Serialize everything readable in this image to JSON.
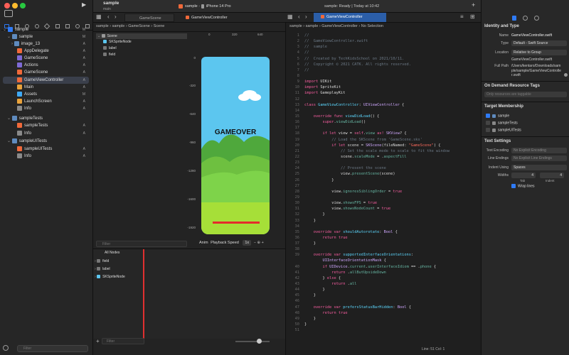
{
  "project": {
    "name": "sample",
    "branch": "main"
  },
  "toolbar": {
    "scheme": "sample",
    "device": "iPhone 14 Pro",
    "status": "sample: Ready | Today at 10:42"
  },
  "tabs": [
    {
      "label": "GameScene"
    },
    {
      "label": "GameViewController"
    }
  ],
  "active_tab": {
    "label": "GameViewController"
  },
  "navigator": {
    "items": [
      {
        "label": "sample",
        "badge": "M"
      },
      {
        "label": "sample",
        "badge": "M"
      },
      {
        "label": "image_13",
        "badge": "A"
      },
      {
        "label": "AppDelegate",
        "badge": "A"
      },
      {
        "label": "GameScene",
        "badge": "A"
      },
      {
        "label": "Actions",
        "badge": "A"
      },
      {
        "label": "GameScene",
        "badge": "A"
      },
      {
        "label": "GameViewController",
        "badge": "A"
      },
      {
        "label": "Main",
        "badge": "A"
      },
      {
        "label": "Assets",
        "badge": "M"
      },
      {
        "label": "LaunchScreen",
        "badge": "A"
      },
      {
        "label": "Info",
        "badge": "A"
      },
      {
        "label": "sampleTests",
        "badge": ""
      },
      {
        "label": "sampleTests",
        "badge": "A"
      },
      {
        "label": "Info",
        "badge": "A"
      },
      {
        "label": "sampleUITests",
        "badge": ""
      },
      {
        "label": "sampleUITests",
        "badge": "A"
      },
      {
        "label": "Info",
        "badge": "A"
      }
    ],
    "filter_placeholder": "Filter"
  },
  "scene_editor": {
    "breadcrumb": [
      "sample",
      "sample",
      "GameScene",
      "Scene"
    ],
    "tree": [
      "Scene",
      "SKSpriteNode",
      "label",
      "field"
    ],
    "ruler_top": [
      "0",
      "320",
      "640"
    ],
    "ruler_left": [
      "0",
      "-320",
      "-640",
      "-960",
      "-1280",
      "-1600",
      "-1920"
    ],
    "game_label": "GAMEOVER",
    "anim_label": "Anim",
    "playback_label": "Playback Speed",
    "speed_value": "1x",
    "filter_placeholder": "Filter",
    "timeline_header": "All Nodes",
    "timeline_rows": [
      "field",
      "label",
      "SKSpriteNode"
    ]
  },
  "code_editor": {
    "breadcrumb": [
      "sample",
      "sample",
      "GameViewController",
      "No Selection"
    ],
    "status": {
      "line": "Line: 51",
      "col": "Col: 1"
    }
  },
  "inspector": {
    "section_identity": "Identity and Type",
    "name_label": "Name",
    "name_value": "GameViewController.swift",
    "type_label": "Type",
    "type_value": "Default - Swift Source",
    "location_label": "Location",
    "location_value": "Relative to Group",
    "location_file": "GameViewController.swift",
    "fullpath_label": "Full Path",
    "fullpath_value": "/Users/kentaro/Downloads/sample/sample/GameViewController.swift",
    "section_ondemand": "On Demand Resource Tags",
    "ondemand_placeholder": "Only resources are taggable",
    "section_target": "Target Membership",
    "targets": [
      "sample",
      "sampleTests",
      "sampleUITests"
    ],
    "section_text": "Text Settings",
    "encoding_label": "Text Encoding",
    "encoding_value": "No Explicit Encoding",
    "lineend_label": "Line Endings",
    "lineend_value": "No Explicit Line Endings",
    "indent_label": "Indent Using",
    "indent_value": "Spaces",
    "widths_label": "Widths",
    "tab_width": "4",
    "indent_width": "4",
    "tab_caption": "Tab",
    "indent_caption": "Indent",
    "wrap_label": "Wrap lines"
  },
  "colors": {
    "accent": "#2f7bf6",
    "selection": "#3a3f4b",
    "sky": "#5cc6ef",
    "grass": "#7ed34a",
    "bar": "#e52b2b"
  }
}
